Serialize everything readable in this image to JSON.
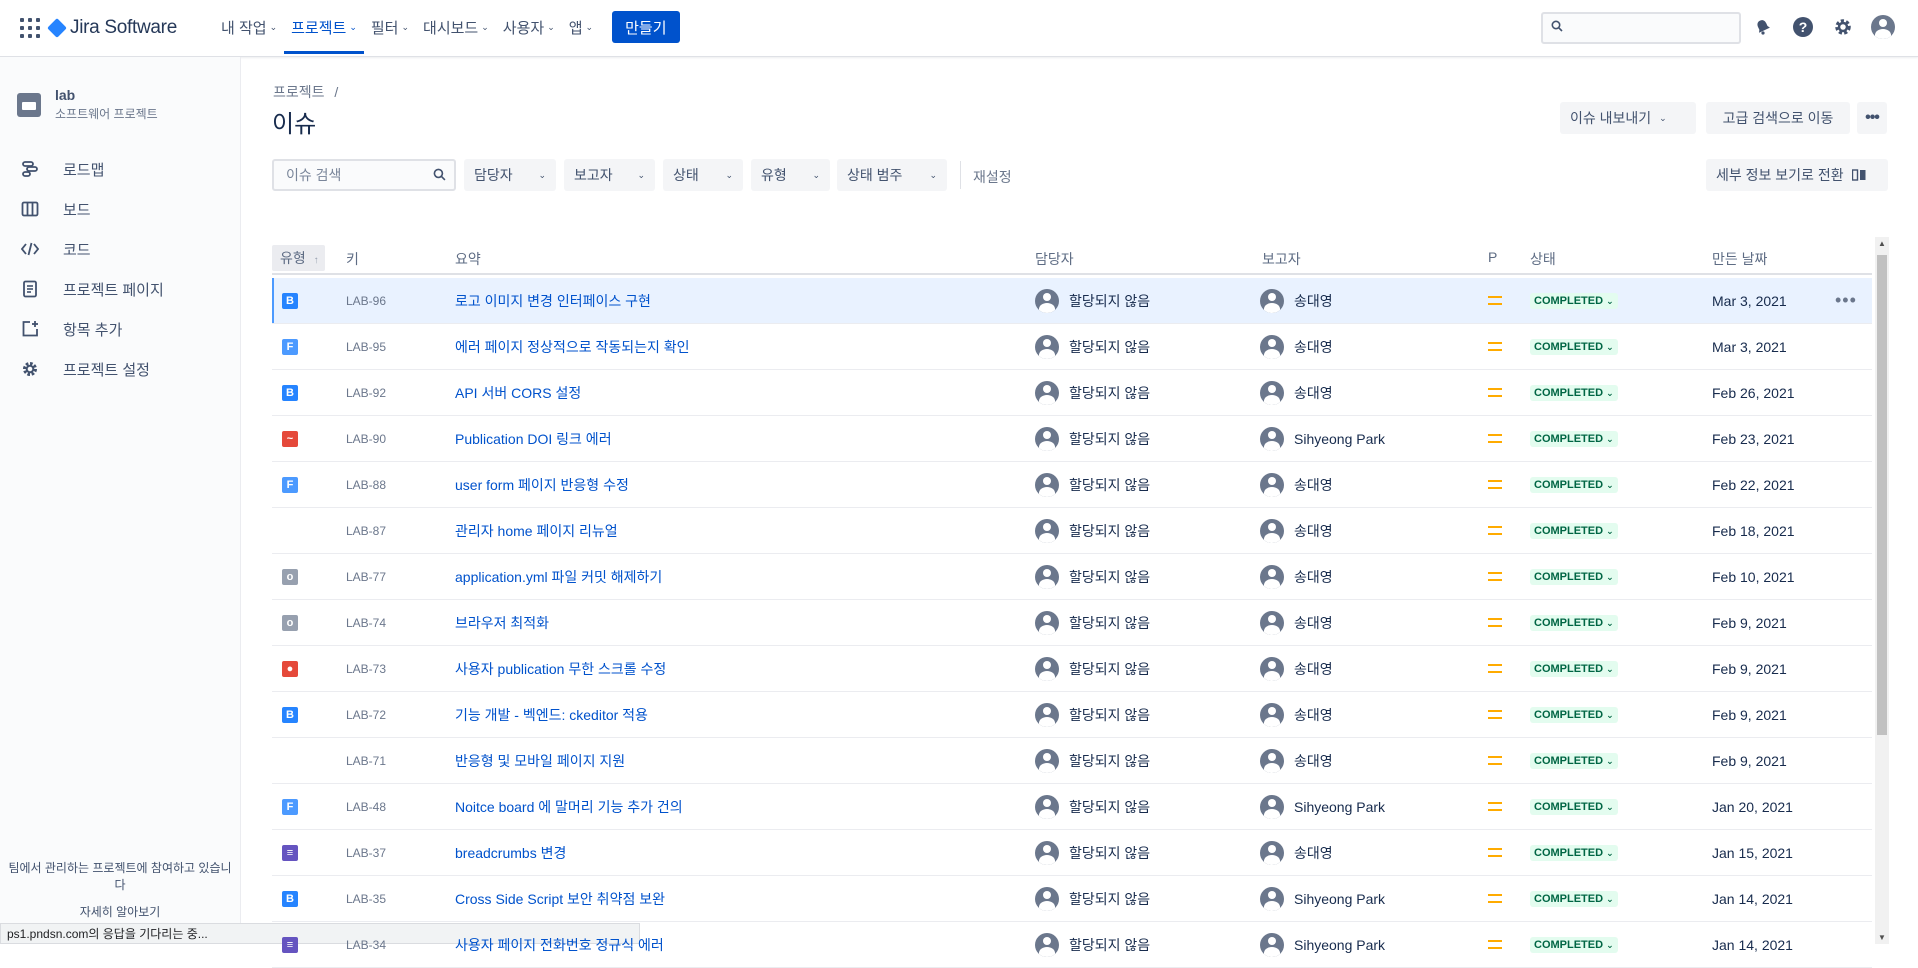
{
  "nav": {
    "logo_text": "Jira Software",
    "items": [
      {
        "label": "내 작업",
        "active": false
      },
      {
        "label": "프로젝트",
        "active": true
      },
      {
        "label": "필터",
        "active": false
      },
      {
        "label": "대시보드",
        "active": false
      },
      {
        "label": "사용자",
        "active": false
      },
      {
        "label": "앱",
        "active": false
      }
    ],
    "create_label": "만들기"
  },
  "sidebar": {
    "project_name": "lab",
    "project_type": "소프트웨어 프로젝트",
    "items": [
      {
        "label": "로드맵",
        "icon": "roadmap-icon"
      },
      {
        "label": "보드",
        "icon": "board-icon"
      },
      {
        "label": "코드",
        "icon": "code-icon"
      },
      {
        "label": "프로젝트 페이지",
        "icon": "page-icon"
      },
      {
        "label": "항목 추가",
        "icon": "add-item-icon"
      },
      {
        "label": "프로젝트 설정",
        "icon": "gear-icon"
      }
    ],
    "footer_text": "팀에서 관리하는 프로젝트에 참여하고 있습니다",
    "footer_link": "자세히 알아보기"
  },
  "status_bar": "ps1.pndsn.com의 응답을 기다리는 중...",
  "header": {
    "breadcrumb": "프로젝트",
    "breadcrumb_sep": "/",
    "title": "이슈",
    "export_label": "이슈 내보내기",
    "advanced_search_label": "고급 검색으로 이동",
    "detail_view_label": "세부 정보 보기로 전환"
  },
  "filters": {
    "search_placeholder": "이슈 검색",
    "assignee": "담당자",
    "reporter": "보고자",
    "status": "상태",
    "type": "유형",
    "status_category": "상태 범주",
    "reset": "재설정"
  },
  "table": {
    "headers": {
      "type": "유형",
      "key": "키",
      "summary": "요약",
      "assignee": "담당자",
      "reporter": "보고자",
      "priority": "P",
      "status": "상태",
      "created": "만든 날짜"
    },
    "rows": [
      {
        "type": "B",
        "type_color": "#2684ff",
        "key": "LAB-96",
        "summary": "로고 이미지 변경 인터페이스 구현",
        "assignee": "할당되지 않음",
        "reporter": "송대영",
        "status": "COMPLETED",
        "created": "Mar 3, 2021"
      },
      {
        "type": "F",
        "type_color": "#4c9aff",
        "key": "LAB-95",
        "summary": "에러 페이지 정상적으로 작동되는지 확인",
        "assignee": "할당되지 않음",
        "reporter": "송대영",
        "status": "COMPLETED",
        "created": "Mar 3, 2021"
      },
      {
        "type": "B",
        "type_color": "#2684ff",
        "key": "LAB-92",
        "summary": "API 서버 CORS 설정",
        "assignee": "할당되지 않음",
        "reporter": "송대영",
        "status": "COMPLETED",
        "created": "Feb 26, 2021"
      },
      {
        "type": "~",
        "type_color": "#e5493a",
        "key": "LAB-90",
        "summary": "Publication DOI 링크 에러",
        "assignee": "할당되지 않음",
        "reporter": "Sihyeong Park",
        "status": "COMPLETED",
        "created": "Feb 23, 2021"
      },
      {
        "type": "F",
        "type_color": "#4c9aff",
        "key": "LAB-88",
        "summary": "user form 페이지 반응형 수정",
        "assignee": "할당되지 않음",
        "reporter": "송대영",
        "status": "COMPLETED",
        "created": "Feb 22, 2021"
      },
      {
        "type": "",
        "type_color": "",
        "key": "LAB-87",
        "summary": "관리자 home 페이지 리뉴얼",
        "assignee": "할당되지 않음",
        "reporter": "송대영",
        "status": "COMPLETED",
        "created": "Feb 18, 2021"
      },
      {
        "type": "o",
        "type_color": "#97a0af",
        "key": "LAB-77",
        "summary": "application.yml 파일 커밋 해제하기",
        "assignee": "할당되지 않음",
        "reporter": "송대영",
        "status": "COMPLETED",
        "created": "Feb 10, 2021"
      },
      {
        "type": "o",
        "type_color": "#97a0af",
        "key": "LAB-74",
        "summary": "브라우저 최적화",
        "assignee": "할당되지 않음",
        "reporter": "송대영",
        "status": "COMPLETED",
        "created": "Feb 9, 2021"
      },
      {
        "type": "●",
        "type_color": "#e5493a",
        "key": "LAB-73",
        "summary": "사용자 publication 무한 스크롤 수정",
        "assignee": "할당되지 않음",
        "reporter": "송대영",
        "status": "COMPLETED",
        "created": "Feb 9, 2021"
      },
      {
        "type": "B",
        "type_color": "#2684ff",
        "key": "LAB-72",
        "summary": "기능 개발 - 벡엔드: ckeditor 적용",
        "assignee": "할당되지 않음",
        "reporter": "송대영",
        "status": "COMPLETED",
        "created": "Feb 9, 2021"
      },
      {
        "type": "",
        "type_color": "",
        "key": "LAB-71",
        "summary": "반응형 및 모바일 페이지 지원",
        "assignee": "할당되지 않음",
        "reporter": "송대영",
        "status": "COMPLETED",
        "created": "Feb 9, 2021"
      },
      {
        "type": "F",
        "type_color": "#4c9aff",
        "key": "LAB-48",
        "summary": "Noitce board 에 말머리 기능 추가 건의",
        "assignee": "할당되지 않음",
        "reporter": "Sihyeong Park",
        "status": "COMPLETED",
        "created": "Jan 20, 2021"
      },
      {
        "type": "≡",
        "type_color": "#6554c0",
        "key": "LAB-37",
        "summary": "breadcrumbs 변경",
        "assignee": "할당되지 않음",
        "reporter": "송대영",
        "status": "COMPLETED",
        "created": "Jan 15, 2021"
      },
      {
        "type": "B",
        "type_color": "#2684ff",
        "key": "LAB-35",
        "summary": "Cross Side Script 보안 취약점 보완",
        "assignee": "할당되지 않음",
        "reporter": "Sihyeong Park",
        "status": "COMPLETED",
        "created": "Jan 14, 2021"
      },
      {
        "type": "≡",
        "type_color": "#6554c0",
        "key": "LAB-34",
        "summary": "사용자 페이지 전화번호 정규식 에러",
        "assignee": "할당되지 않음",
        "reporter": "Sihyeong Park",
        "status": "COMPLETED",
        "created": "Jan 14, 2021"
      }
    ]
  }
}
